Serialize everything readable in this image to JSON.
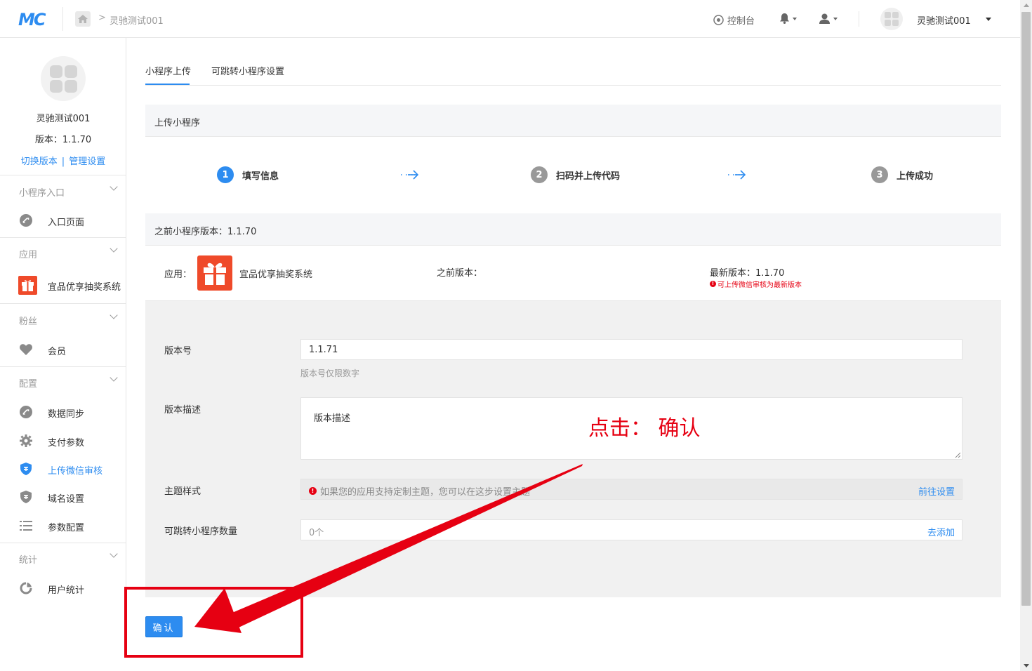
{
  "header": {
    "logo": "MC",
    "breadcrumb": "灵驰测试001",
    "console": "控制台",
    "account_name": "灵驰测试001"
  },
  "sidebar": {
    "name": "灵驰测试001",
    "version": "版本：1.1.70",
    "switch_version": "切换版本",
    "separator": "|",
    "manage_settings": "管理设置",
    "groups": [
      {
        "label": "小程序入口",
        "items": [
          {
            "label": "入口页面",
            "icon": "link-icon"
          }
        ]
      },
      {
        "label": "应用",
        "items": [
          {
            "label": "宜品优享抽奖系统",
            "icon": "gift-icon"
          }
        ]
      },
      {
        "label": "粉丝",
        "items": [
          {
            "label": "会员",
            "icon": "heart-icon"
          }
        ]
      },
      {
        "label": "配置",
        "items": [
          {
            "label": "数据同步",
            "icon": "link-icon"
          },
          {
            "label": "支付参数",
            "icon": "gear-icon"
          },
          {
            "label": "上传微信审核",
            "icon": "shield-icon",
            "active": true
          },
          {
            "label": "域名设置",
            "icon": "shield-icon"
          },
          {
            "label": "参数配置",
            "icon": "list-icon"
          }
        ]
      },
      {
        "label": "统计",
        "items": [
          {
            "label": "用户统计",
            "icon": "pie-icon"
          }
        ]
      }
    ]
  },
  "tabs": [
    {
      "label": "小程序上传",
      "active": true
    },
    {
      "label": "可跳转小程序设置",
      "active": false
    }
  ],
  "upload_section_title": "上传小程序",
  "steps": [
    {
      "num": "1",
      "label": "填写信息",
      "active": true
    },
    {
      "num": "2",
      "label": "扫码并上传代码",
      "active": false
    },
    {
      "num": "3",
      "label": "上传成功",
      "active": false
    }
  ],
  "prev_version_title": "之前小程序版本：1.1.70",
  "app_row": {
    "app_label": "应用：",
    "app_name": "宜品优享抽奖系统",
    "prev_version_label": "之前版本：",
    "latest_version": "最新版本：1.1.70",
    "latest_tip": "可上传微信审核为最新版本"
  },
  "form": {
    "version_label": "版本号",
    "version_value": "1.1.71",
    "version_help": "版本号仅限数字",
    "desc_label": "版本描述",
    "desc_placeholder": "版本描述",
    "theme_label": "主题样式",
    "theme_tip": "如果您的应用支持定制主题，您可以在这步设置主题",
    "theme_link": "前往设置",
    "jump_label": "可跳转小程序数量",
    "jump_value": "0个",
    "jump_link": "去添加"
  },
  "confirm_label": "确认",
  "annotation": {
    "text": "点击： 确认",
    "color": "#e60012"
  },
  "colors": {
    "accent": "#2d8cf0",
    "warn": "#e60012",
    "gift": "#ef4a2a"
  }
}
